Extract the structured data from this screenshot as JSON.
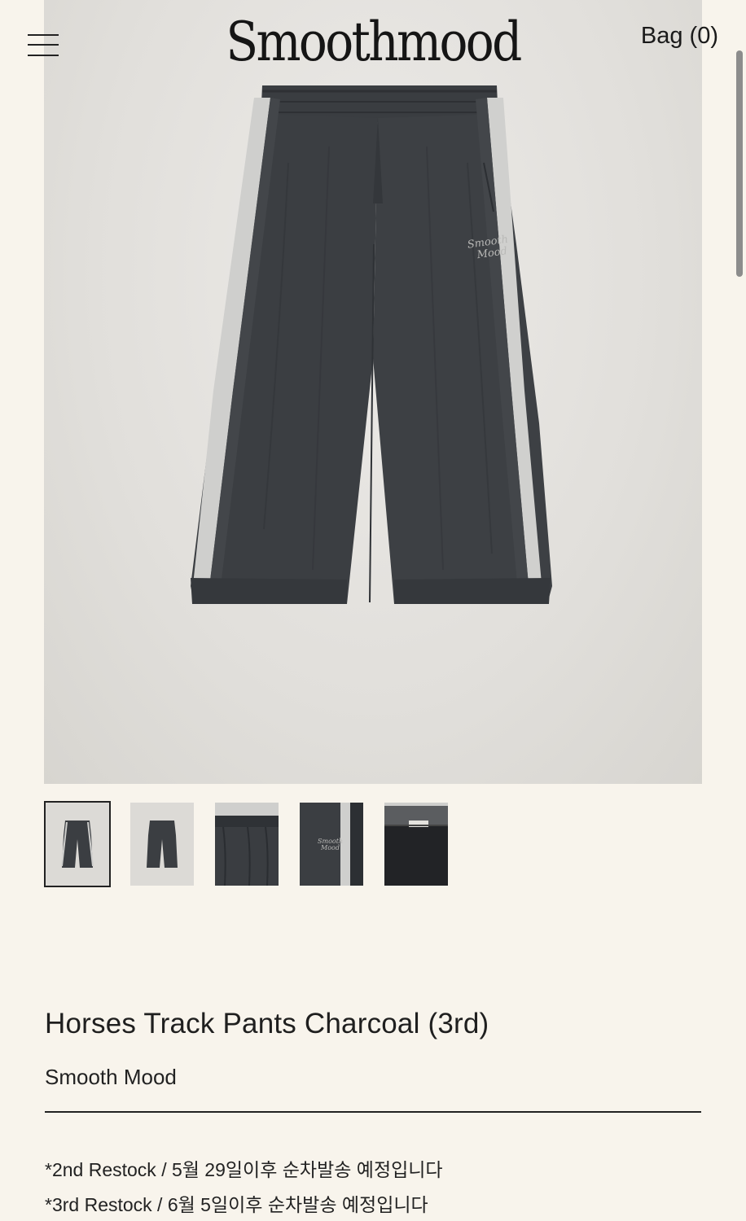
{
  "header": {
    "logo": "Smoothmood",
    "bag_label": "Bag (0)",
    "menu_icon": "hamburger-menu-icon"
  },
  "gallery": {
    "thumbnails": [
      {
        "view": "front-full",
        "selected": true
      },
      {
        "view": "back-full",
        "selected": false
      },
      {
        "view": "waistband-detail",
        "selected": false
      },
      {
        "view": "logo-detail",
        "selected": false
      },
      {
        "view": "inner-label-detail",
        "selected": false
      }
    ]
  },
  "product": {
    "title": "Horses Track Pants Charcoal (3rd)",
    "brand": "Smooth Mood",
    "notices": [
      "*2nd Restock / 5월 29일이후 순차발송 예정입니다",
      "*3rd Restock / 6월 5일이후 순차발송 예정입니다"
    ]
  },
  "colors": {
    "background": "#f8f4ec",
    "pants": "#3b3e42",
    "stripe": "#c9c9c7"
  }
}
